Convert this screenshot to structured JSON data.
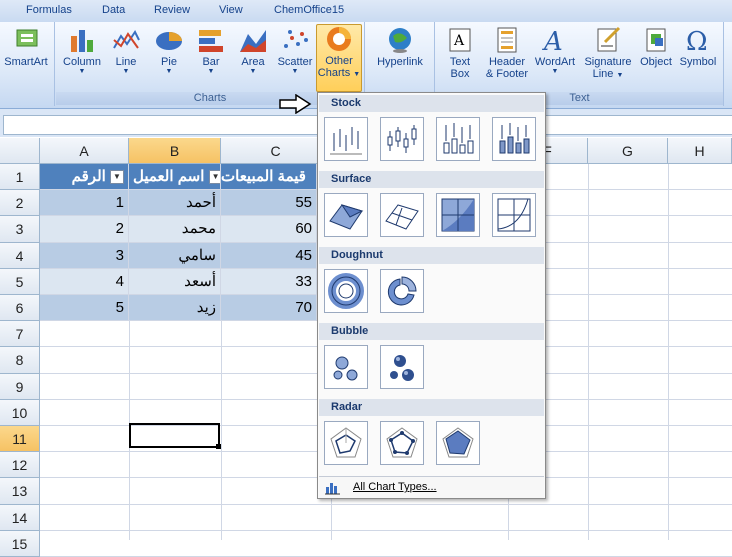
{
  "tabs": [
    "Formulas",
    "Data",
    "Review",
    "View",
    "ChemOffice15"
  ],
  "ribbon": {
    "smartart": "SmartArt",
    "charts_group": "Charts",
    "chart_buttons": [
      "Column",
      "Line",
      "Pie",
      "Bar",
      "Area",
      "Scatter"
    ],
    "other_charts_line1": "Other",
    "other_charts_line2": "Charts",
    "hyperlink": "Hyperlink",
    "text_box_line1": "Text",
    "text_box_line2": "Box",
    "header_footer_line1": "Header",
    "header_footer_line2": "& Footer",
    "wordart": "WordArt",
    "signature_line1": "Signature",
    "signature_line2": "Line",
    "object": "Object",
    "symbol": "Symbol",
    "text_group": "Text"
  },
  "columns": [
    "A",
    "B",
    "C",
    "F",
    "G",
    "H"
  ],
  "rows": [
    "1",
    "2",
    "3",
    "4",
    "5",
    "6",
    "7",
    "8",
    "9",
    "10",
    "11",
    "12",
    "13",
    "14",
    "15"
  ],
  "table": {
    "headers": [
      "الرقم",
      "اسم العميل",
      "قيمة المبيعات"
    ],
    "rows": [
      {
        "id": "1",
        "name": "أحمد",
        "sales": "55"
      },
      {
        "id": "2",
        "name": "محمد",
        "sales": "60"
      },
      {
        "id": "3",
        "name": "سامي",
        "sales": "45"
      },
      {
        "id": "4",
        "name": "أسعد",
        "sales": "33"
      },
      {
        "id": "5",
        "name": "زيد",
        "sales": "70"
      }
    ]
  },
  "menu": {
    "sections": [
      "Stock",
      "Surface",
      "Doughnut",
      "Bubble",
      "Radar"
    ],
    "all_chart_types": "All Chart Types..."
  },
  "colors": {
    "header_fill": "#4f81bd",
    "band_dark": "#b8cce4",
    "band_light": "#dce6f1",
    "selected_header": "#f6c264"
  }
}
